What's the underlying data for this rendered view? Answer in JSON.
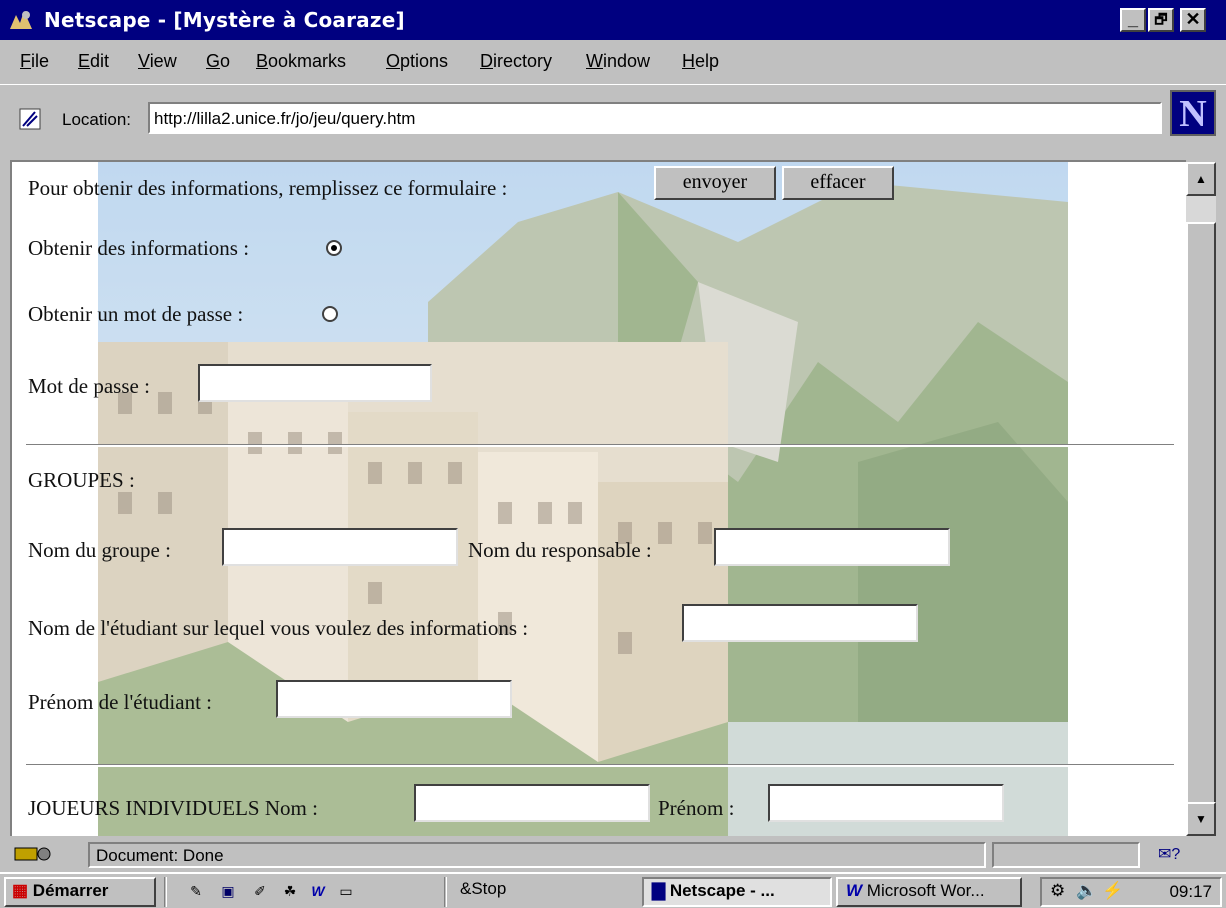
{
  "window": {
    "title": "Netscape - [Mystère à Coaraze]",
    "controls": [
      "_",
      "🗗",
      "✕"
    ]
  },
  "menu": [
    "File",
    "Edit",
    "View",
    "Go",
    "Bookmarks",
    "Options",
    "Directory",
    "Window",
    "Help"
  ],
  "location": {
    "label": "Location:",
    "url": "http://lilla2.unice.fr/jo/jeu/query.htm"
  },
  "logo": "N",
  "form": {
    "intro": "Pour obtenir des informations, remplissez ce formulaire :",
    "submit_label": "envoyer",
    "reset_label": "effacer",
    "opt_info_label": "Obtenir des informations :",
    "opt_password_label": "Obtenir un mot de passe :",
    "password_label": "Mot de passe :",
    "groups_heading": "GROUPES :",
    "group_name_label": "Nom du groupe :",
    "manager_name_label": "Nom du responsable :",
    "student_name_label": "Nom de l'étudiant sur lequel vous voulez des informations :",
    "student_firstname_label": "Prénom de l'étudiant :",
    "individual_label": "JOUEURS INDIVIDUELS Nom :",
    "firstname_label": "Prénom :"
  },
  "status": {
    "text": "Document: Done"
  },
  "taskbar": {
    "start_label": "Démarrer",
    "task_stop": "&Stop",
    "task_netscape": "Netscape - ...",
    "task_word": "Microsoft Wor...",
    "clock": "09:17"
  },
  "icons": [
    "netscape-icon",
    "location-icon",
    "security-icon",
    "mail-icon",
    "windows-logo-icon",
    "word-icon",
    "speaker-icon"
  ]
}
